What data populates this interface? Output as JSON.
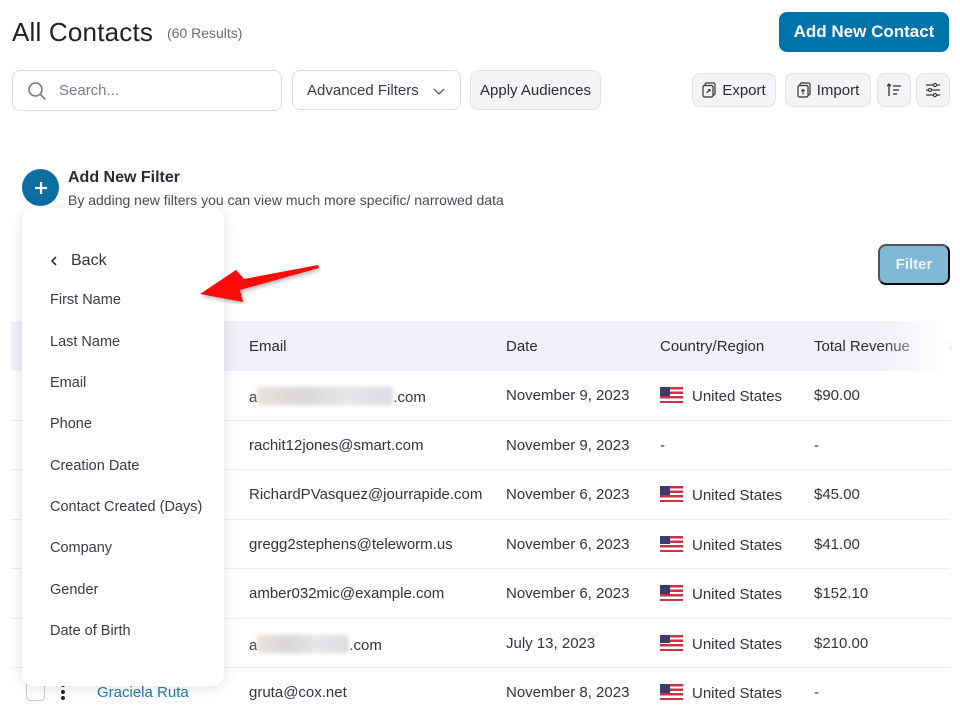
{
  "header": {
    "title": "All Contacts",
    "results_count": "(60 Results)",
    "add_contact_label": "Add New Contact"
  },
  "toolbar": {
    "search_placeholder": "Search...",
    "search_value": "",
    "advanced_filters_label": "Advanced Filters",
    "apply_audiences_label": "Apply Audiences",
    "export_label": "Export",
    "import_label": "Import"
  },
  "add_filter": {
    "title": "Add New Filter",
    "description": "By adding new filters you can view much more specific/ narrowed data",
    "filter_button_label": "Filter"
  },
  "filter_menu": {
    "back_label": "Back",
    "items": [
      "First Name",
      "Last Name",
      "Email",
      "Phone",
      "Creation Date",
      "Contact Created (Days)",
      "Company",
      "Gender",
      "Date of Birth"
    ]
  },
  "table": {
    "columns": [
      "Email",
      "Date",
      "Country/Region",
      "Total Revenue",
      "S"
    ],
    "rows": [
      {
        "name": "",
        "email_prefix": "a",
        "email_suffix": ".com",
        "email_redacted": true,
        "email": "",
        "date": "November 9, 2023",
        "country": "United States",
        "flag": "us-flag-icon",
        "revenue": "$90.00"
      },
      {
        "name": "",
        "email_prefix": "",
        "email_suffix": "",
        "email_redacted": false,
        "email": "rachit12jones@smart.com",
        "date": "November 9, 2023",
        "country": "-",
        "flag": "",
        "revenue": "-"
      },
      {
        "name": "",
        "email_prefix": "",
        "email_suffix": "",
        "email_redacted": false,
        "email": "RichardPVasquez@jourrapide.com",
        "date": "November 6, 2023",
        "country": "United States",
        "flag": "us-flag-icon",
        "revenue": "$45.00"
      },
      {
        "name": "",
        "email_prefix": "",
        "email_suffix": "",
        "email_redacted": false,
        "email": "gregg2stephens@teleworm.us",
        "date": "November 6, 2023",
        "country": "United States",
        "flag": "us-flag-icon",
        "revenue": "$41.00"
      },
      {
        "name": "",
        "email_prefix": "",
        "email_suffix": "",
        "email_redacted": false,
        "email": "amber032mic@example.com",
        "date": "November 6, 2023",
        "country": "United States",
        "flag": "us-flag-icon",
        "revenue": "$152.10"
      },
      {
        "name": "",
        "email_prefix": "a",
        "email_suffix": ".com",
        "email_redacted": true,
        "email": "",
        "date": "July 13, 2023",
        "country": "United States",
        "flag": "us-flag-icon",
        "revenue": "$210.00"
      },
      {
        "name": "Graciela Ruta",
        "email_prefix": "",
        "email_suffix": "",
        "email_redacted": false,
        "email": "gruta@cox.net",
        "date": "November 8, 2023",
        "country": "United States",
        "flag": "us-flag-icon",
        "revenue": "-"
      }
    ]
  },
  "annotation": {
    "arrow_color": "#ff0000"
  },
  "colors": {
    "primary": "#0073aa",
    "filter_disabled": "#7fb9d6",
    "link": "#1e7ab8",
    "table_header_bg": "#f0f1f8"
  }
}
